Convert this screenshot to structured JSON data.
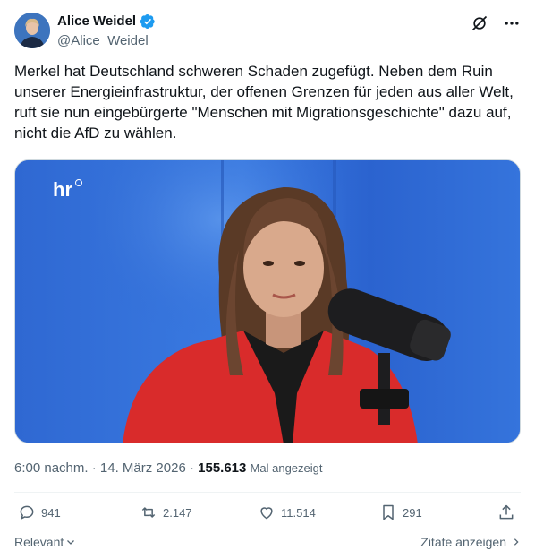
{
  "author": {
    "display_name": "Alice Weidel",
    "handle": "@Alice_Weidel"
  },
  "tweet": {
    "text": "Merkel hat Deutschland schweren Schaden zugefügt. Neben dem Ruin unserer Energieinfrastruktur, der offenen Grenzen für jeden aus aller Welt, ruft sie nun eingebürgerte \"Menschen mit Migrationsgeschichte\" dazu auf, nicht die AfD zu wählen."
  },
  "media": {
    "watermark": "hr"
  },
  "meta": {
    "time": "6:00 nachm.",
    "separator": " · ",
    "date": "14. März 2026",
    "views_count": "155.613",
    "views_label": "Mal angezeigt"
  },
  "actions": {
    "replies": "941",
    "reposts": "2.147",
    "likes": "11.514",
    "bookmarks": "291"
  },
  "footer": {
    "relevant": "Relevant",
    "quotes": "Zitate anzeigen"
  },
  "colors": {
    "text": "#0f1419",
    "secondary": "#536471",
    "verified": "#1d9bf0",
    "divider": "#eff3f4"
  }
}
